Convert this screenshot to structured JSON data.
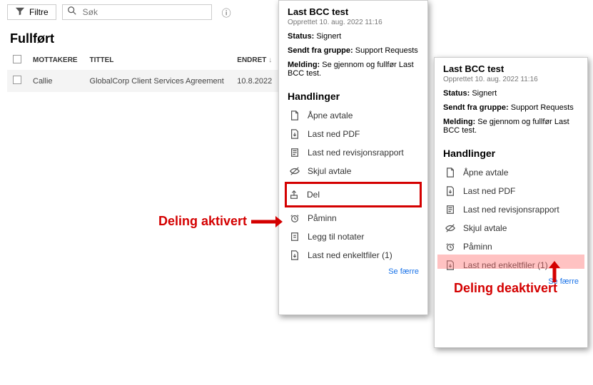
{
  "toolbar": {
    "filter_label": "Filtre",
    "search_placeholder": "Søk"
  },
  "page_title": "Fullført",
  "table": {
    "headers": {
      "recipients": "MOTTAKERE",
      "title": "TITTEL",
      "modified": "ENDRET"
    },
    "row": {
      "recipients": "Callie",
      "title": "GlobalCorp Client Services Agreement",
      "modified": "10.8.2022"
    }
  },
  "panel": {
    "title": "Last BCC test",
    "created": "Opprettet 10. aug. 2022 11:16",
    "status_label": "Status:",
    "status_value": "Signert",
    "group_label": "Sendt fra gruppe:",
    "group_value": "Support Requests",
    "message_label": "Melding:",
    "message_value": "Se gjennom og fullfør Last BCC test.",
    "actions_header": "Handlinger",
    "actions": {
      "open": "Åpne avtale",
      "download_pdf": "Last ned PDF",
      "download_audit": "Last ned revisjonsrapport",
      "hide": "Skjul avtale",
      "share": "Del",
      "remind": "Påminn",
      "notes": "Legg til notater",
      "download_files": "Last ned enkeltfiler (1)"
    },
    "see_less": "Se færre"
  },
  "callouts": {
    "enabled": "Deling aktivert",
    "disabled": "Deling deaktivert"
  }
}
